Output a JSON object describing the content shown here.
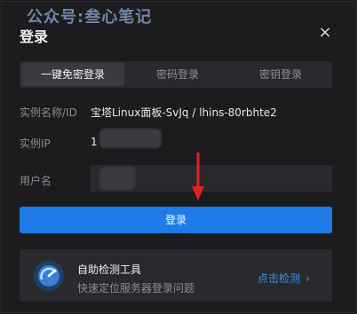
{
  "watermark": "公众号:叁心笔记",
  "dialog": {
    "title": "登录",
    "close_glyph": "×"
  },
  "tabs": [
    {
      "label": "一键免密登录",
      "active": true
    },
    {
      "label": "密码登录",
      "active": false
    },
    {
      "label": "密钥登录",
      "active": false
    }
  ],
  "fields": {
    "instance_name": {
      "label": "实例名称/ID",
      "value": "宝塔Linux面板-SvJq / lhins-80rbhte2"
    },
    "instance_ip": {
      "label": "实例IP",
      "value": "1"
    },
    "username": {
      "label": "用户名",
      "value": ""
    }
  },
  "login_button": "登录",
  "tool": {
    "icon": "speedometer-icon",
    "title": "自助检测工具",
    "desc": "快速定位服务器登录问题",
    "link": "点击检测",
    "link_glyph": "›"
  },
  "colors": {
    "accent": "#1e7ce8",
    "arrow": "#e02020"
  }
}
